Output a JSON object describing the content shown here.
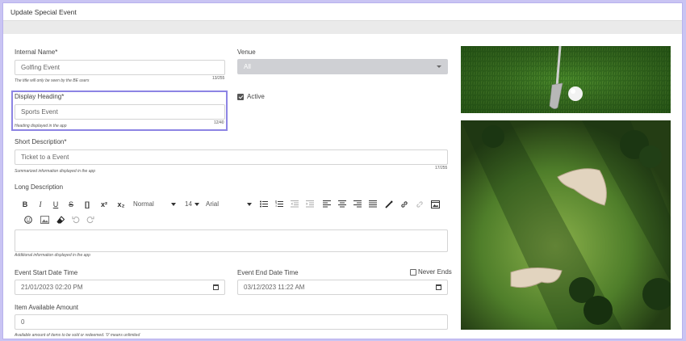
{
  "window": {
    "title": "Update Special Event"
  },
  "form": {
    "internal_name": {
      "label": "Internal Name*",
      "value": "Golfing Event",
      "hint": "The title will only be seen by the BE users",
      "counter": "13/255"
    },
    "venue": {
      "label": "Venue",
      "value": "All"
    },
    "display_heading": {
      "label": "Display Heading*",
      "value": "Sports Event",
      "hint": "Heading displayed in the app",
      "counter": "12/40"
    },
    "active": {
      "label": "Active",
      "checked": true
    },
    "short_description": {
      "label": "Short Description*",
      "value": "Ticket to a Event",
      "hint": "Summarized information displayed in the app",
      "counter": "17/255"
    },
    "long_description": {
      "label": "Long Description",
      "hint": "Additional information displayed in the app",
      "toolbar": {
        "bold": "B",
        "italic": "I",
        "underline": "U",
        "strike": "S",
        "code": "[]",
        "superscript": "x²",
        "subscript": "x₂",
        "format": "Normal",
        "size": "14",
        "font": "Arial"
      }
    },
    "start_datetime": {
      "label": "Event Start Date Time",
      "value": "21/01/2023 02:20 PM"
    },
    "end_datetime": {
      "label": "Event End Date Time",
      "value": "03/12/2023 11:22 AM"
    },
    "never_ends": {
      "label": "Never Ends",
      "checked": false
    },
    "item_available": {
      "label": "Item Available Amount",
      "value": "0",
      "hint": "Available amount of items to be sold or redeemed. '0' means unlimited"
    }
  },
  "colors": {
    "accent": "#8d84e4",
    "background": "#c9c4f3",
    "grass": "#3f7a2a"
  }
}
